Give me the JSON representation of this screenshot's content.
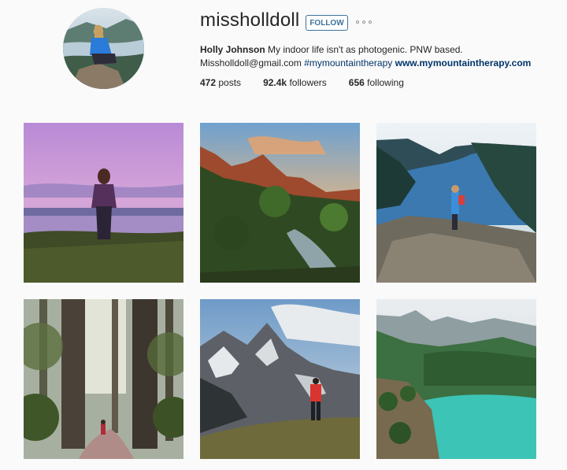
{
  "profile": {
    "username": "missholldoll",
    "follow_label": "FOLLOW",
    "bio": {
      "name": "Holly Johnson",
      "text": " My indoor life isn't as photogenic. PNW based.",
      "email": "Missholldoll@gmail.com ",
      "hashtag": "#mymountaintherapy",
      "link": "www.mymountaintherapy.com"
    },
    "stats": {
      "posts_count": "472",
      "posts_label": "posts",
      "followers_count": "92.4k",
      "followers_label": "followers",
      "following_count": "656",
      "following_label": "following"
    }
  },
  "colors": {
    "accent": "#3f729b",
    "link": "#003569",
    "background": "#fafafa"
  },
  "icons": {
    "more": "more-dots-icon"
  }
}
